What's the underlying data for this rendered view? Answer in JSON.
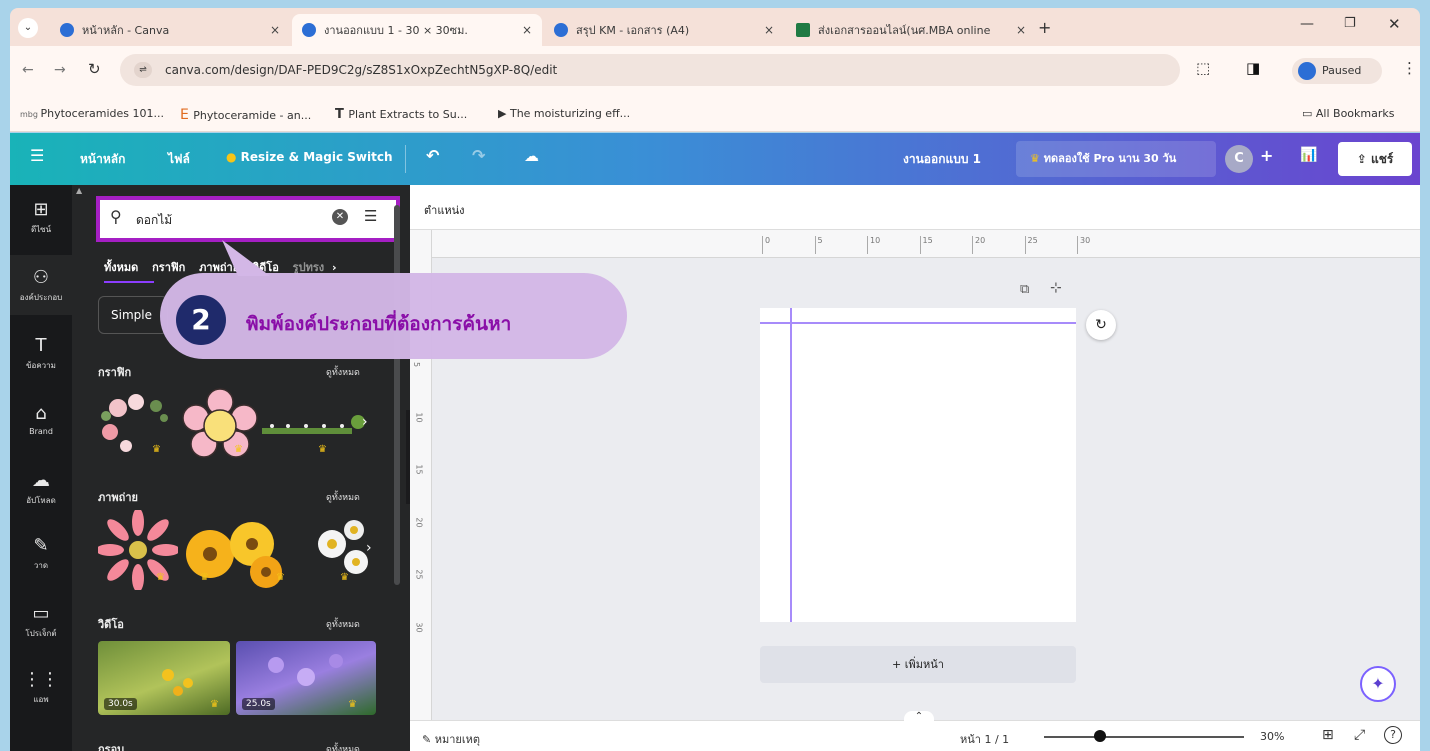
{
  "browser": {
    "tabs": [
      {
        "label": "หน้าหลัก - Canva",
        "close": "×"
      },
      {
        "label": "งานออกแบบ 1 - 30 × 30ซม.",
        "close": "×"
      },
      {
        "label": "สรุป KM - เอกสาร (A4)",
        "close": "×"
      },
      {
        "label": "ส่งเอกสารออนไลน์(นศ.MBA online",
        "close": "×"
      }
    ],
    "new_tab": "+",
    "url": "canva.com/design/DAF-PED9C2g/sZ8S1xOxpZechtN5gXP-8Q/edit",
    "profile_status": "Paused",
    "bookmarks": [
      "Phytoceramides 101...",
      "Phytoceramide - an...",
      "Plant Extracts to Su...",
      "The moisturizing eff..."
    ],
    "all_bookmarks": "All Bookmarks"
  },
  "canva_header": {
    "home": "หน้าหลัก",
    "file": "ไฟล์",
    "resize": "Resize & Magic Switch",
    "design_title": "งานออกแบบ 1",
    "pro_trial": "ทดลองใช้ Pro นาน 30 วัน",
    "avatar_initial": "C",
    "share": "แชร์"
  },
  "rail": [
    {
      "icon": "⊞",
      "label": "ดีไซน์"
    },
    {
      "icon": "⚇",
      "label": "องค์ประกอบ"
    },
    {
      "icon": "T",
      "label": "ข้อความ"
    },
    {
      "icon": "⌂",
      "label": "Brand"
    },
    {
      "icon": "☁",
      "label": "อัปโหลด"
    },
    {
      "icon": "✎",
      "label": "วาด"
    },
    {
      "icon": "▭",
      "label": "โปรเจ็กต์"
    },
    {
      "icon": "⋮⋮",
      "label": "แอพ"
    }
  ],
  "panel": {
    "search_value": "ดอกไม้",
    "filter_tabs": [
      "ทั้งหมด",
      "กราฟิก",
      "ภาพถ่าย",
      "วิดีโอ",
      "รูปทรง"
    ],
    "chip": "Simple",
    "sections": [
      {
        "title": "กราฟิก",
        "see_all": "ดูทั้งหมด"
      },
      {
        "title": "ภาพถ่าย",
        "see_all": "ดูทั้งหมด"
      },
      {
        "title": "วิดีโอ",
        "see_all": "ดูทั้งหมด"
      },
      {
        "title": "กรอบ",
        "see_all": "ดูทั้งหมด"
      }
    ],
    "video_durations": [
      "30.0s",
      "25.0s"
    ]
  },
  "editor": {
    "position_label": "ตำแหน่ง",
    "ruler_ticks": [
      "0",
      "5",
      "10",
      "15",
      "20",
      "25",
      "30"
    ],
    "left_ruler_ticks": [
      "5",
      "10",
      "15",
      "20",
      "25",
      "30"
    ],
    "add_page": "+ เพิ่มหน้า",
    "notes": "หมายเหตุ",
    "page_counter": "หน้า 1 / 1",
    "zoom": "30%"
  },
  "callout": {
    "number": "2",
    "text": "พิมพ์องค์ประกอบที่ต้องการค้นหา"
  },
  "colors": {
    "highlight_border": "#a51fc4",
    "callout_bg": "#d3b7e6",
    "callout_text": "#8a0ea8",
    "callout_badge": "#1f2a6b"
  }
}
